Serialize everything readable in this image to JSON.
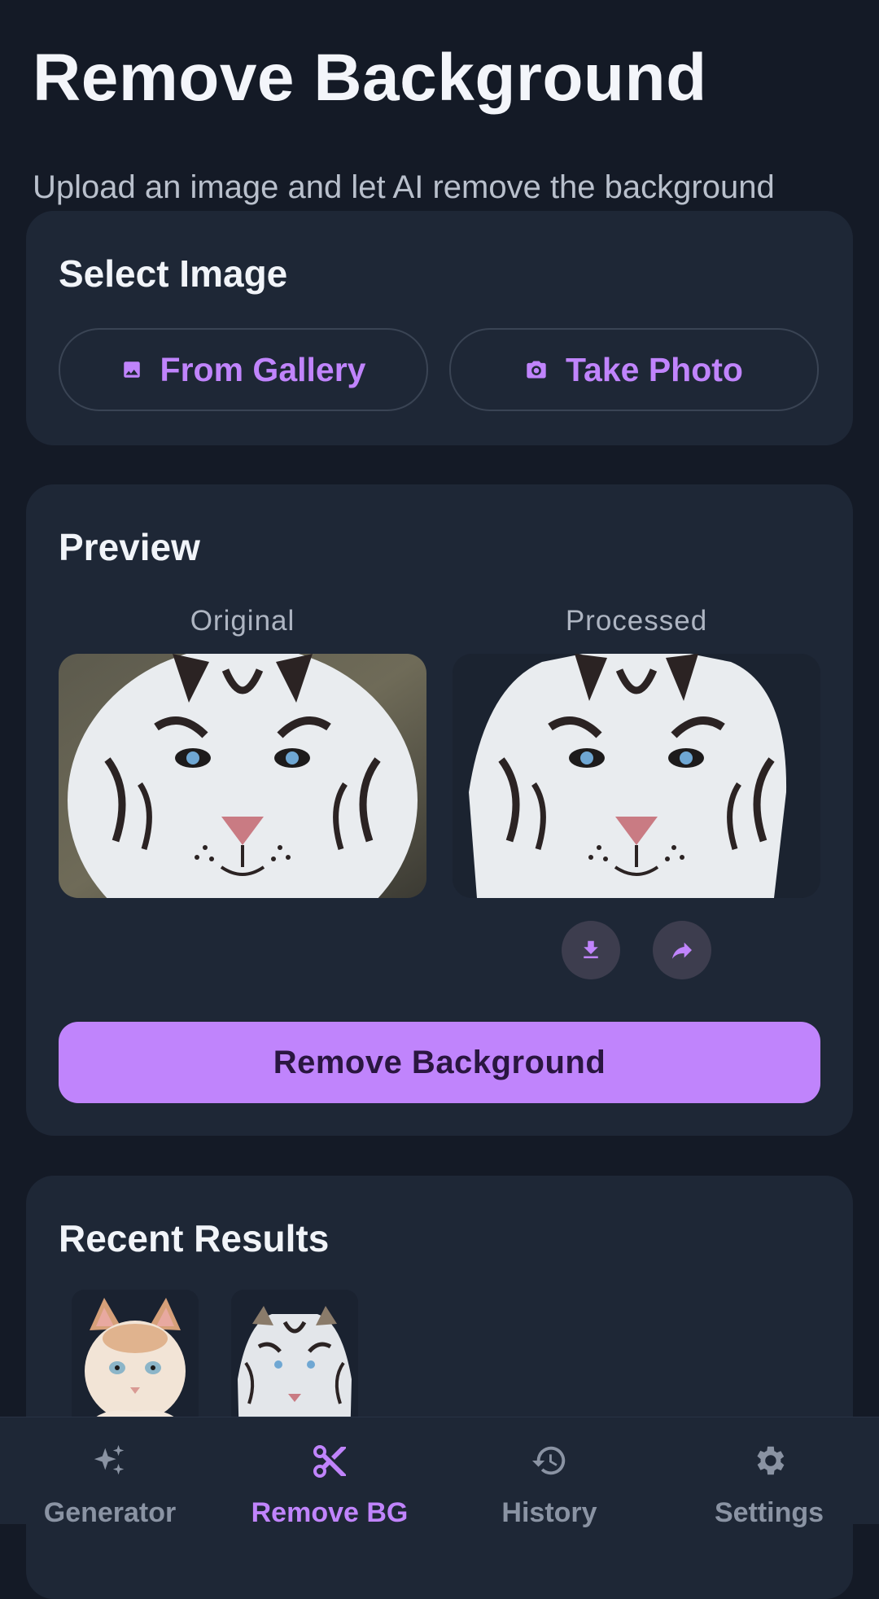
{
  "header": {
    "title": "Remove Background",
    "subtitle": "Upload an image and let AI remove the background"
  },
  "select_image": {
    "title": "Select Image",
    "gallery_label": "From Gallery",
    "photo_label": "Take Photo"
  },
  "preview": {
    "title": "Preview",
    "original_label": "Original",
    "processed_label": "Processed",
    "action_label": "Remove Background"
  },
  "recent": {
    "title": "Recent Results"
  },
  "nav": {
    "items": [
      {
        "label": "Generator",
        "icon": "sparkle-icon"
      },
      {
        "label": "Remove BG",
        "icon": "scissors-icon"
      },
      {
        "label": "History",
        "icon": "history-icon"
      },
      {
        "label": "Settings",
        "icon": "gear-icon"
      }
    ],
    "active_index": 1
  },
  "colors": {
    "accent": "#c084fc",
    "background": "#141a26",
    "card": "#1e2736"
  }
}
